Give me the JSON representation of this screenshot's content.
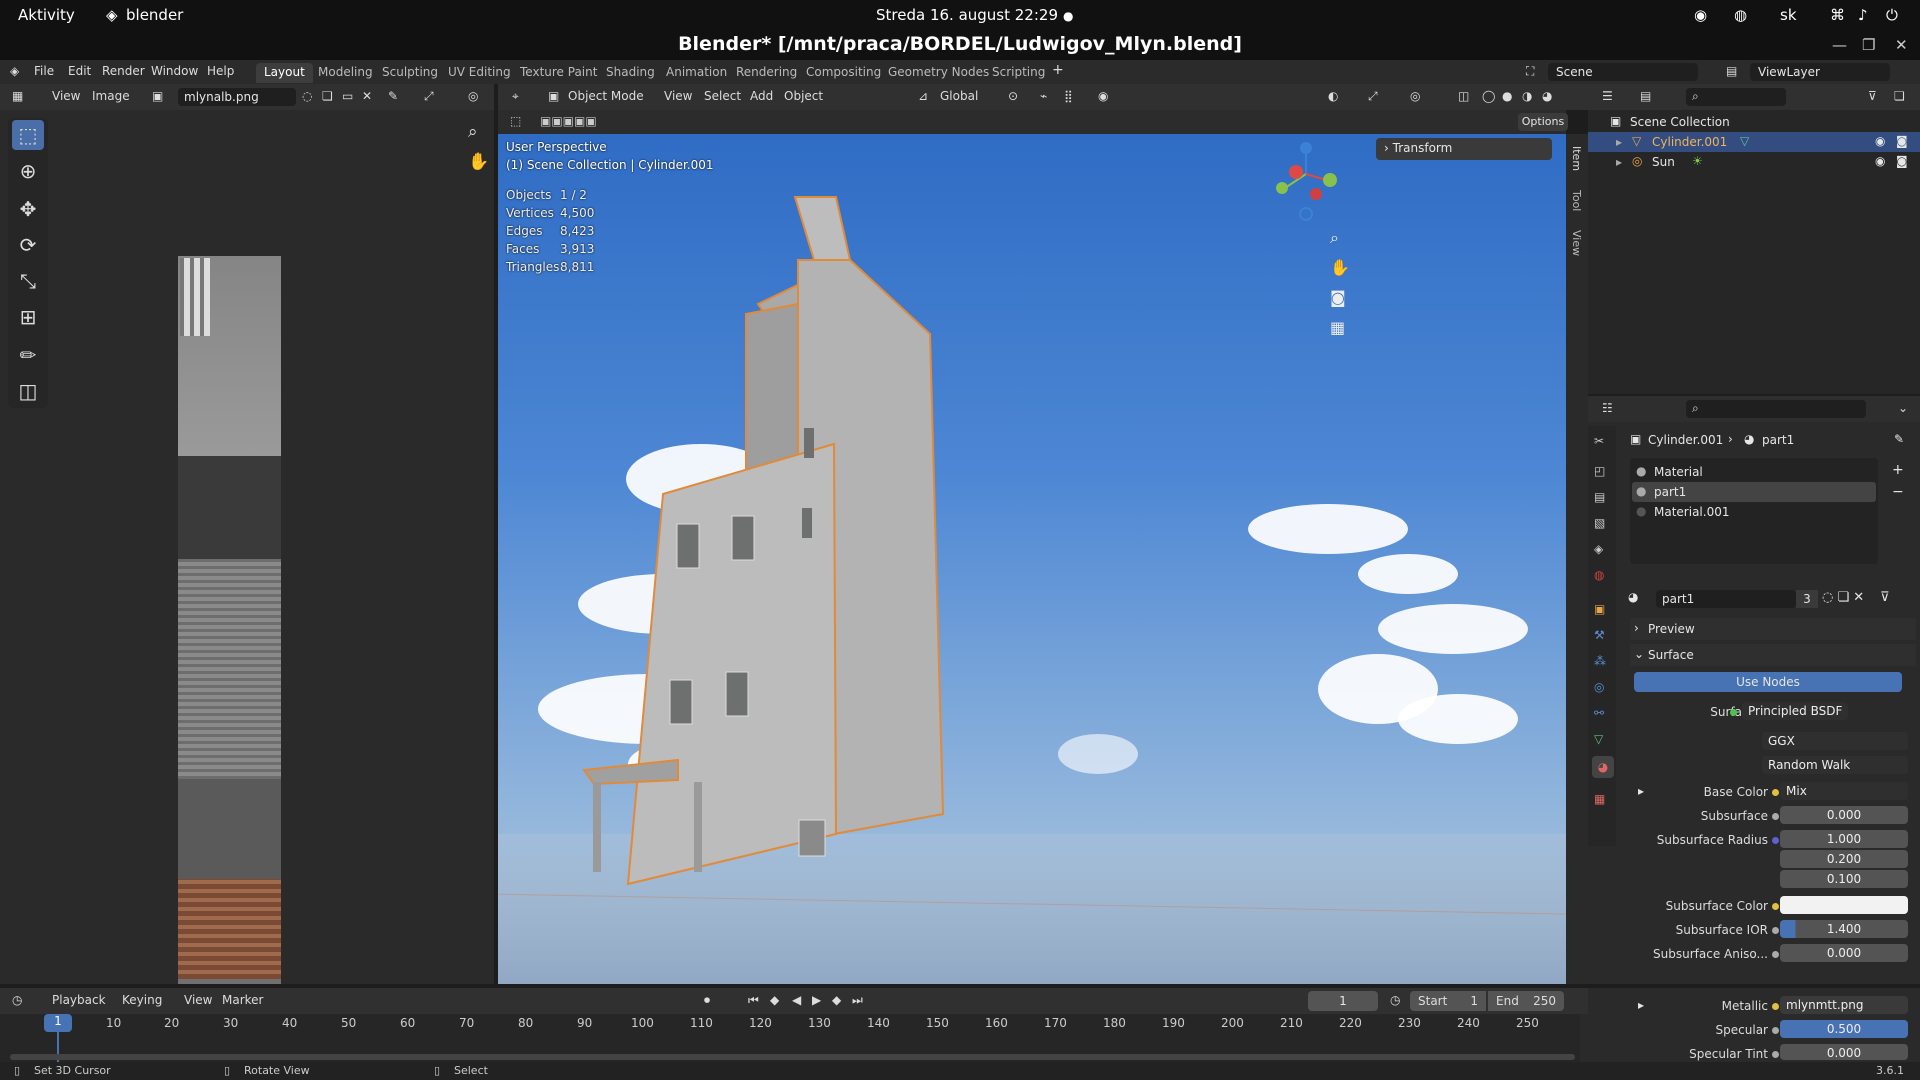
{
  "gnome": {
    "activities": "Aktivity",
    "app": "blender",
    "clock": "Streda 16. august  22:29",
    "lang": "sk"
  },
  "window": {
    "title": "Blender* [/mnt/praca/BORDEL/Ludwigov_Mlyn.blend]"
  },
  "menu": {
    "items": [
      "File",
      "Edit",
      "Render",
      "Window",
      "Help"
    ],
    "workspaces": [
      "Layout",
      "Modeling",
      "Sculpting",
      "UV Editing",
      "Texture Paint",
      "Shading",
      "Animation",
      "Rendering",
      "Compositing",
      "Geometry Nodes",
      "Scripting"
    ],
    "active": "Layout",
    "scene": "Scene",
    "view_layer": "ViewLayer"
  },
  "image_editor": {
    "view": "View",
    "image_menu": "Image",
    "image_name": "mlynalb.png"
  },
  "viewport_header": {
    "mode": "Object Mode",
    "view": "View",
    "select": "Select",
    "add": "Add",
    "object": "Object",
    "orientation": "Global",
    "options": "Options"
  },
  "viewport": {
    "perspective": "User Perspective",
    "collection": "(1) Scene Collection | Cylinder.001",
    "stats": [
      {
        "label": "Objects",
        "value": "1 / 2"
      },
      {
        "label": "Vertices",
        "value": "4,500"
      },
      {
        "label": "Edges",
        "value": "8,423"
      },
      {
        "label": "Faces",
        "value": "3,913"
      },
      {
        "label": "Triangles",
        "value": "8,811"
      }
    ],
    "transform_panel": "Transform",
    "side_tabs": [
      "Item",
      "Tool",
      "View"
    ]
  },
  "outliner": {
    "root": "Scene Collection",
    "items": [
      {
        "name": "Cylinder.001",
        "selected": true
      },
      {
        "name": "Sun",
        "selected": false
      }
    ]
  },
  "properties": {
    "breadcrumb_object": "Cylinder.001",
    "breadcrumb_material": "part1",
    "slots": [
      "Material",
      "part1",
      "Material.001"
    ],
    "material_name": "part1",
    "users": "3",
    "preview": "Preview",
    "surface_section": "Surface",
    "use_nodes": "Use Nodes",
    "surface": "Principled BSDF",
    "distribution": "GGX",
    "subsurface_method": "Random Walk",
    "rows": [
      {
        "label": "Base Color",
        "value": "Mix"
      },
      {
        "label": "Subsurface",
        "value": "0.000"
      },
      {
        "label": "Subsurface Radius",
        "value": "1.000"
      },
      {
        "label": "",
        "value": "0.200"
      },
      {
        "label": "",
        "value": "0.100"
      },
      {
        "label": "Subsurface Color",
        "value": ""
      },
      {
        "label": "Subsurface IOR",
        "value": "1.400"
      },
      {
        "label": "Subsurface Aniso...",
        "value": "0.000"
      },
      {
        "label": "Metallic",
        "value": "mlynmtt.png"
      },
      {
        "label": "Specular",
        "value": "0.500"
      },
      {
        "label": "Specular Tint",
        "value": "0.000"
      }
    ]
  },
  "timeline": {
    "playback": "Playback",
    "keying": "Keying",
    "view": "View",
    "marker": "Marker",
    "current": "1",
    "start_label": "Start",
    "start": "1",
    "end_label": "End",
    "end": "250",
    "ticks": [
      "1",
      "10",
      "20",
      "30",
      "40",
      "50",
      "60",
      "70",
      "80",
      "90",
      "100",
      "110",
      "120",
      "130",
      "140",
      "150",
      "160",
      "170",
      "180",
      "190",
      "200",
      "210",
      "220",
      "230",
      "240",
      "250"
    ]
  },
  "status": {
    "left": "Set 3D Cursor",
    "mid": "Rotate View",
    "right": "Select",
    "version": "3.6.1"
  }
}
